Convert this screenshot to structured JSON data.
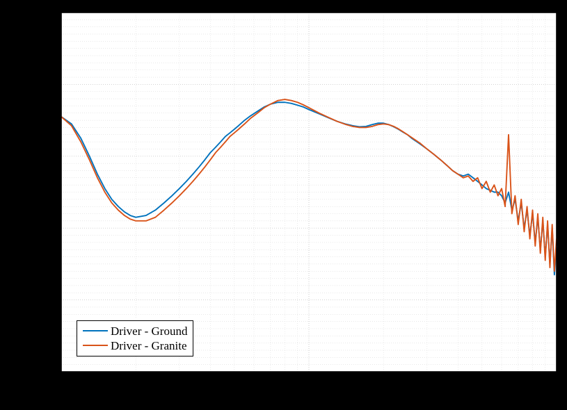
{
  "chart_data": {
    "type": "line",
    "title": "",
    "xlabel": "",
    "ylabel": "",
    "x_scale": "log",
    "xlim": [
      10,
      1000
    ],
    "ylim": [
      -80,
      20
    ],
    "grid": true,
    "legend_position": "lower-left",
    "series": [
      {
        "name": "Driver - Ground",
        "color": "#0072BD",
        "x": [
          10,
          11,
          12,
          13,
          14,
          15,
          16,
          17,
          18,
          19,
          20,
          22,
          24,
          26,
          28,
          30,
          32,
          34,
          36,
          38,
          40,
          42,
          44,
          46,
          48,
          50,
          52,
          55,
          58,
          62,
          66,
          70,
          75,
          80,
          85,
          90,
          95,
          100,
          110,
          120,
          130,
          140,
          150,
          160,
          170,
          180,
          190,
          200,
          210,
          220,
          230,
          240,
          250,
          260,
          280,
          300,
          320,
          340,
          360,
          380,
          400,
          420,
          440,
          460,
          480,
          500,
          520,
          540,
          560,
          580,
          600,
          620,
          640,
          660,
          680,
          700,
          720,
          740,
          760,
          780,
          800,
          820,
          840,
          860,
          880,
          900,
          920,
          940,
          960,
          980,
          1000
        ],
        "y": [
          -9,
          -11,
          -15,
          -20,
          -25,
          -29,
          -32,
          -34,
          -35.5,
          -36.5,
          -37,
          -36.5,
          -35,
          -33,
          -31,
          -29,
          -27,
          -25,
          -23,
          -21,
          -19,
          -17.5,
          -16,
          -14.5,
          -13.5,
          -12.5,
          -11.5,
          -10,
          -8.8,
          -7.5,
          -6.3,
          -5.5,
          -5,
          -5,
          -5.3,
          -5.8,
          -6.3,
          -7,
          -8.2,
          -9.3,
          -10.3,
          -11,
          -11.5,
          -11.8,
          -11.7,
          -11.2,
          -10.8,
          -10.8,
          -11.2,
          -11.8,
          -12.5,
          -13.3,
          -14,
          -15,
          -16.5,
          -18,
          -19.5,
          -21,
          -22.5,
          -24,
          -25,
          -25.5,
          -25,
          -26,
          -27,
          -28,
          -29,
          -29.5,
          -30,
          -30,
          -31,
          -33,
          -30,
          -35,
          -32,
          -38,
          -33,
          -40,
          -35,
          -42,
          -36,
          -44,
          -37,
          -46,
          -38,
          -48,
          -39,
          -50,
          -40,
          -53,
          -45
        ]
      },
      {
        "name": "Driver - Granite",
        "color": "#D95319",
        "x": [
          10,
          11,
          12,
          13,
          14,
          15,
          16,
          17,
          18,
          19,
          20,
          22,
          24,
          26,
          28,
          30,
          32,
          34,
          36,
          38,
          40,
          42,
          44,
          46,
          48,
          50,
          52,
          55,
          58,
          62,
          66,
          70,
          75,
          80,
          85,
          90,
          95,
          100,
          110,
          120,
          130,
          140,
          150,
          160,
          170,
          180,
          190,
          200,
          210,
          220,
          230,
          240,
          250,
          260,
          280,
          300,
          320,
          340,
          360,
          380,
          400,
          420,
          440,
          460,
          480,
          500,
          520,
          540,
          560,
          580,
          600,
          620,
          640,
          660,
          680,
          700,
          720,
          740,
          760,
          780,
          800,
          820,
          840,
          860,
          880,
          900,
          920,
          940,
          960,
          980,
          1000
        ],
        "y": [
          -9,
          -11.5,
          -16,
          -21,
          -26,
          -30,
          -33,
          -35,
          -36.5,
          -37.5,
          -38,
          -38,
          -37,
          -35,
          -33,
          -31,
          -29,
          -27,
          -25,
          -23,
          -21,
          -19,
          -17.5,
          -16,
          -14.5,
          -13.5,
          -12.5,
          -11,
          -9.5,
          -8,
          -6.5,
          -5.5,
          -4.5,
          -4.2,
          -4.5,
          -5,
          -5.7,
          -6.5,
          -8,
          -9.2,
          -10.3,
          -11.1,
          -11.7,
          -12,
          -12,
          -11.7,
          -11.2,
          -11,
          -11.2,
          -11.7,
          -12.4,
          -13.2,
          -14,
          -14.8,
          -16.3,
          -18,
          -19.5,
          -21,
          -22.5,
          -24,
          -25,
          -26,
          -25.5,
          -27,
          -26,
          -29,
          -27,
          -30,
          -28,
          -31,
          -29,
          -34,
          -14,
          -36,
          -31,
          -39,
          -32,
          -41,
          -34,
          -43,
          -35,
          -45,
          -36,
          -47,
          -37,
          -49,
          -38,
          -51,
          -39,
          -52,
          -43
        ]
      }
    ]
  },
  "legend": {
    "items": [
      {
        "label": "Driver - Ground",
        "color": "#0072BD"
      },
      {
        "label": "Driver - Granite",
        "color": "#D95319"
      }
    ]
  }
}
